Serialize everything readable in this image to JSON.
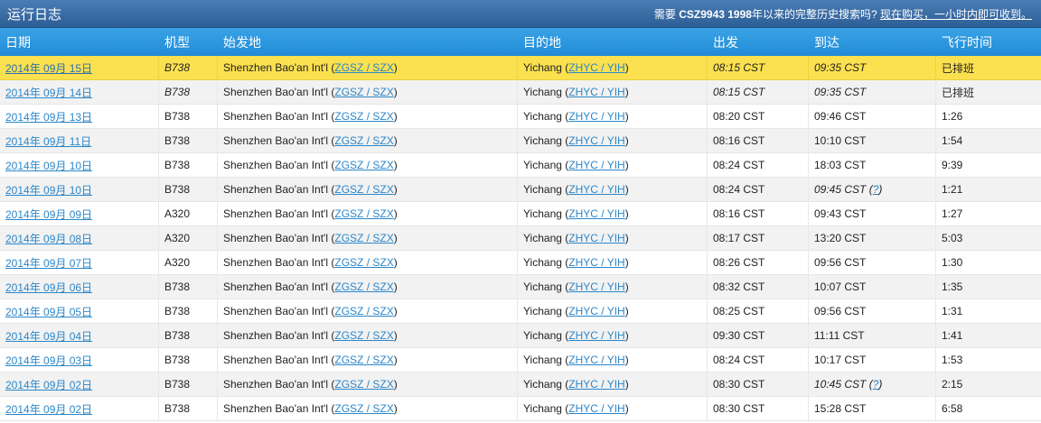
{
  "header": {
    "title": "运行日志",
    "promo_prefix": "需要",
    "promo_strong": "CSZ9943 1998",
    "promo_mid": "年以来的完整历史搜索吗?",
    "promo_link": "现在购买，一小时内即可收到。"
  },
  "columns": [
    "日期",
    "机型",
    "始发地",
    "目的地",
    "出发",
    "到达",
    "飞行时间"
  ],
  "rows": [
    {
      "date": "2014年 09月 15日",
      "aircraft": "B738",
      "aircraft_italic": true,
      "origin_name": "Shenzhen Bao'an Int'l",
      "origin_code": "ZGSZ / SZX",
      "dest_name": "Yichang",
      "dest_code": "ZHYC / YIH",
      "dep": "08:15 CST",
      "dep_italic": true,
      "arr": "09:35 CST",
      "arr_italic": true,
      "arr_q": "",
      "dur": "已排班",
      "style": "highlight"
    },
    {
      "date": "2014年 09月 14日",
      "aircraft": "B738",
      "aircraft_italic": true,
      "origin_name": "Shenzhen Bao'an Int'l",
      "origin_code": "ZGSZ / SZX",
      "dest_name": "Yichang",
      "dest_code": "ZHYC / YIH",
      "dep": "08:15 CST",
      "dep_italic": true,
      "arr": "09:35 CST",
      "arr_italic": true,
      "arr_q": "",
      "dur": "已排班",
      "style": "even"
    },
    {
      "date": "2014年 09月 13日",
      "aircraft": "B738",
      "aircraft_italic": false,
      "origin_name": "Shenzhen Bao'an Int'l",
      "origin_code": "ZGSZ / SZX",
      "dest_name": "Yichang",
      "dest_code": "ZHYC / YIH",
      "dep": "08:20 CST",
      "dep_italic": false,
      "arr": "09:46 CST",
      "arr_italic": false,
      "arr_q": "",
      "dur": "1:26",
      "style": "odd"
    },
    {
      "date": "2014年 09月 11日",
      "aircraft": "B738",
      "aircraft_italic": false,
      "origin_name": "Shenzhen Bao'an Int'l",
      "origin_code": "ZGSZ / SZX",
      "dest_name": "Yichang",
      "dest_code": "ZHYC / YIH",
      "dep": "08:16 CST",
      "dep_italic": false,
      "arr": "10:10 CST",
      "arr_italic": false,
      "arr_q": "",
      "dur": "1:54",
      "style": "even"
    },
    {
      "date": "2014年 09月 10日",
      "aircraft": "B738",
      "aircraft_italic": false,
      "origin_name": "Shenzhen Bao'an Int'l",
      "origin_code": "ZGSZ / SZX",
      "dest_name": "Yichang",
      "dest_code": "ZHYC / YIH",
      "dep": "08:24 CST",
      "dep_italic": false,
      "arr": "18:03 CST",
      "arr_italic": false,
      "arr_q": "",
      "dur": "9:39",
      "style": "odd"
    },
    {
      "date": "2014年 09月 10日",
      "aircraft": "B738",
      "aircraft_italic": false,
      "origin_name": "Shenzhen Bao'an Int'l",
      "origin_code": "ZGSZ / SZX",
      "dest_name": "Yichang",
      "dest_code": "ZHYC / YIH",
      "dep": "08:24 CST",
      "dep_italic": false,
      "arr": "09:45 CST",
      "arr_italic": true,
      "arr_q": "?",
      "dur": "1:21",
      "style": "even"
    },
    {
      "date": "2014年 09月 09日",
      "aircraft": "A320",
      "aircraft_italic": false,
      "origin_name": "Shenzhen Bao'an Int'l",
      "origin_code": "ZGSZ / SZX",
      "dest_name": "Yichang",
      "dest_code": "ZHYC / YIH",
      "dep": "08:16 CST",
      "dep_italic": false,
      "arr": "09:43 CST",
      "arr_italic": false,
      "arr_q": "",
      "dur": "1:27",
      "style": "odd"
    },
    {
      "date": "2014年 09月 08日",
      "aircraft": "A320",
      "aircraft_italic": false,
      "origin_name": "Shenzhen Bao'an Int'l",
      "origin_code": "ZGSZ / SZX",
      "dest_name": "Yichang",
      "dest_code": "ZHYC / YIH",
      "dep": "08:17 CST",
      "dep_italic": false,
      "arr": "13:20 CST",
      "arr_italic": false,
      "arr_q": "",
      "dur": "5:03",
      "style": "even"
    },
    {
      "date": "2014年 09月 07日",
      "aircraft": "A320",
      "aircraft_italic": false,
      "origin_name": "Shenzhen Bao'an Int'l",
      "origin_code": "ZGSZ / SZX",
      "dest_name": "Yichang",
      "dest_code": "ZHYC / YIH",
      "dep": "08:26 CST",
      "dep_italic": false,
      "arr": "09:56 CST",
      "arr_italic": false,
      "arr_q": "",
      "dur": "1:30",
      "style": "odd"
    },
    {
      "date": "2014年 09月 06日",
      "aircraft": "B738",
      "aircraft_italic": false,
      "origin_name": "Shenzhen Bao'an Int'l",
      "origin_code": "ZGSZ / SZX",
      "dest_name": "Yichang",
      "dest_code": "ZHYC / YIH",
      "dep": "08:32 CST",
      "dep_italic": false,
      "arr": "10:07 CST",
      "arr_italic": false,
      "arr_q": "",
      "dur": "1:35",
      "style": "even"
    },
    {
      "date": "2014年 09月 05日",
      "aircraft": "B738",
      "aircraft_italic": false,
      "origin_name": "Shenzhen Bao'an Int'l",
      "origin_code": "ZGSZ / SZX",
      "dest_name": "Yichang",
      "dest_code": "ZHYC / YIH",
      "dep": "08:25 CST",
      "dep_italic": false,
      "arr": "09:56 CST",
      "arr_italic": false,
      "arr_q": "",
      "dur": "1:31",
      "style": "odd"
    },
    {
      "date": "2014年 09月 04日",
      "aircraft": "B738",
      "aircraft_italic": false,
      "origin_name": "Shenzhen Bao'an Int'l",
      "origin_code": "ZGSZ / SZX",
      "dest_name": "Yichang",
      "dest_code": "ZHYC / YIH",
      "dep": "09:30 CST",
      "dep_italic": false,
      "arr": "11:11 CST",
      "arr_italic": false,
      "arr_q": "",
      "dur": "1:41",
      "style": "even"
    },
    {
      "date": "2014年 09月 03日",
      "aircraft": "B738",
      "aircraft_italic": false,
      "origin_name": "Shenzhen Bao'an Int'l",
      "origin_code": "ZGSZ / SZX",
      "dest_name": "Yichang",
      "dest_code": "ZHYC / YIH",
      "dep": "08:24 CST",
      "dep_italic": false,
      "arr": "10:17 CST",
      "arr_italic": false,
      "arr_q": "",
      "dur": "1:53",
      "style": "odd"
    },
    {
      "date": "2014年 09月 02日",
      "aircraft": "B738",
      "aircraft_italic": false,
      "origin_name": "Shenzhen Bao'an Int'l",
      "origin_code": "ZGSZ / SZX",
      "dest_name": "Yichang",
      "dest_code": "ZHYC / YIH",
      "dep": "08:30 CST",
      "dep_italic": false,
      "arr": "10:45 CST",
      "arr_italic": true,
      "arr_q": "?",
      "dur": "2:15",
      "style": "even"
    },
    {
      "date": "2014年 09月 02日",
      "aircraft": "B738",
      "aircraft_italic": false,
      "origin_name": "Shenzhen Bao'an Int'l",
      "origin_code": "ZGSZ / SZX",
      "dest_name": "Yichang",
      "dest_code": "ZHYC / YIH",
      "dep": "08:30 CST",
      "dep_italic": false,
      "arr": "15:28 CST",
      "arr_italic": false,
      "arr_q": "",
      "dur": "6:58",
      "style": "odd"
    }
  ]
}
